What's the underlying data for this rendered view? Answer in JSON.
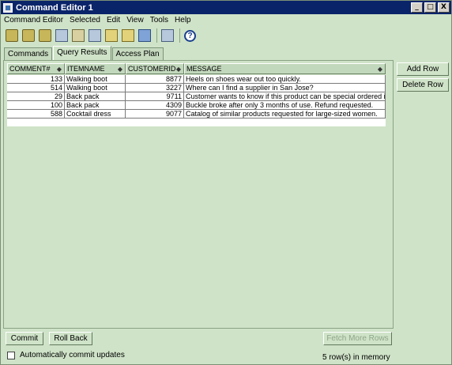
{
  "window": {
    "title": "Command Editor 1",
    "controls": [
      "_",
      "□",
      "X"
    ]
  },
  "menubar": [
    "Command Editor",
    "Selected",
    "Edit",
    "View",
    "Tools",
    "Help"
  ],
  "toolbar": {
    "icons": [
      "execute-icon",
      "explain-icon",
      "query-builder-icon",
      "script-icon",
      "open-icon",
      "save-icon",
      "find-icon",
      "options-icon",
      "monitor-icon",
      "results-icon",
      "help-icon"
    ]
  },
  "tabs": [
    "Commands",
    "Query Results",
    "Access Plan"
  ],
  "active_tab": "Query Results",
  "table": {
    "columns": [
      "COMMENT#",
      "ITEMNAME",
      "CUSTOMERID",
      "MESSAGE"
    ],
    "rows": [
      [
        "133",
        "Walking boot",
        "8877",
        "Heels on shoes wear out too quickly."
      ],
      [
        "514",
        "Walking boot",
        "3227",
        "Where can I find a supplier in San Jose?"
      ],
      [
        "29",
        "Back pack",
        "9711",
        "Customer wants to know if this product can be special ordered in bri..."
      ],
      [
        "100",
        "Back pack",
        "4309",
        "Buckle broke after only 3 months of use.  Refund requested."
      ],
      [
        "588",
        "Cocktail dress",
        "9077",
        "Catalog of similar products requested for large-sized women."
      ]
    ]
  },
  "side_buttons": {
    "add_row": "Add Row",
    "delete_row": "Delete Row"
  },
  "bottom": {
    "commit": "Commit",
    "rollback": "Roll Back",
    "fetch_more": "Fetch More Rows",
    "auto_commit_label": "Automatically commit updates",
    "status": "5 row(s) in memory"
  }
}
